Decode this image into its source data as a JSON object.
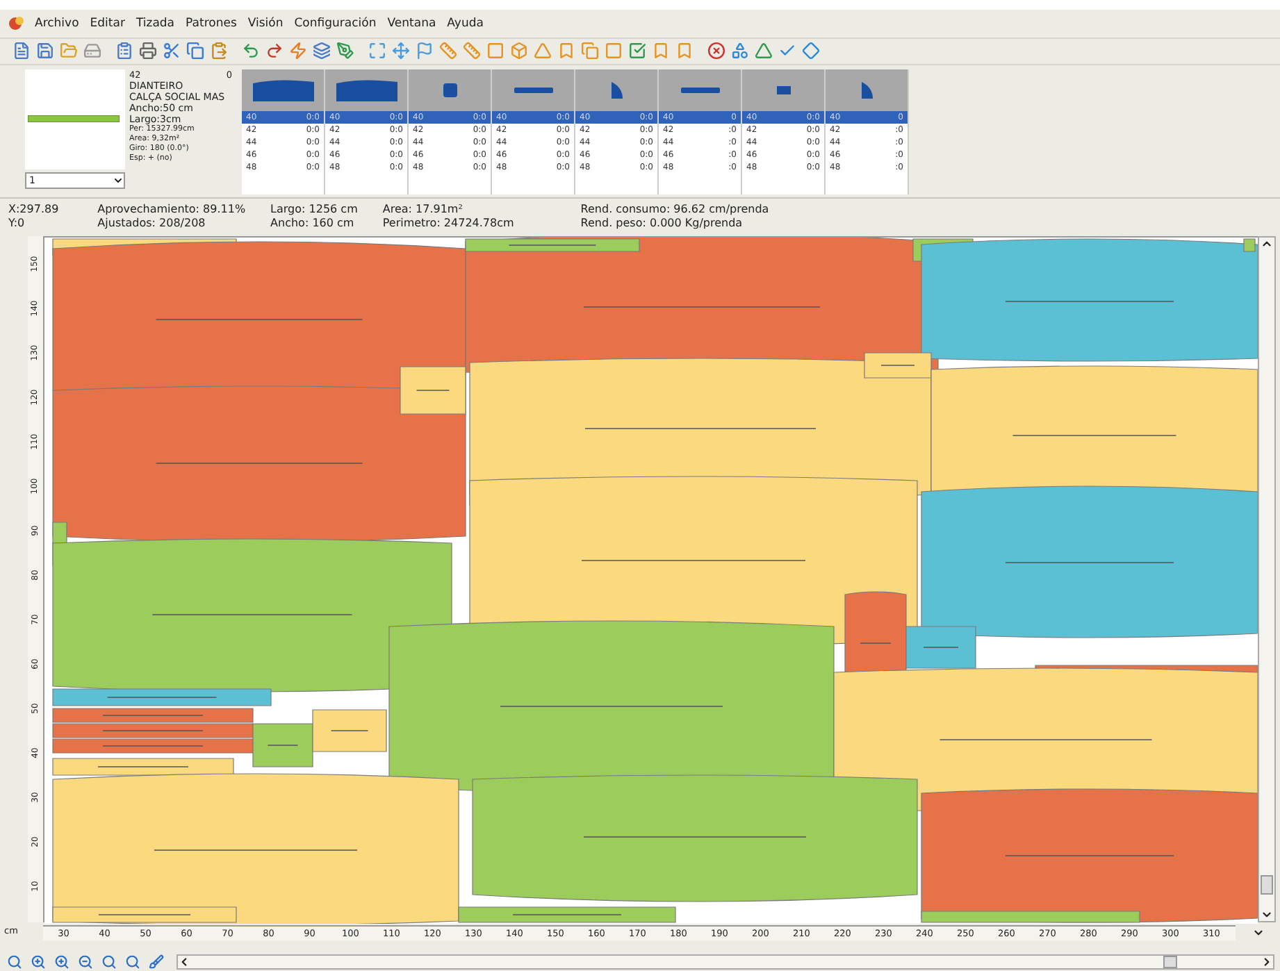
{
  "menu": [
    "Archivo",
    "Editar",
    "Tizada",
    "Patrones",
    "Visión",
    "Configuración",
    "Ventana",
    "Ayuda"
  ],
  "piece_info": {
    "size": "42",
    "count": "0",
    "lines": [
      "DIANTEIRO",
      "CALÇA SOCIAL MAS",
      "Ancho:50 cm",
      "Largo:3cm"
    ],
    "details": [
      "Per: 15327.99cm",
      "Area: 9,32m²",
      "Giro: 180 (0.0°)",
      "Esp: + (no)"
    ],
    "selector": "1"
  },
  "piece_columns": [
    {
      "kind": "panel",
      "rows": [
        {
          "size": "40",
          "qty": "0:0",
          "selected": true
        },
        {
          "size": "42",
          "qty": "0:0",
          "selected": false
        },
        {
          "size": "44",
          "qty": "0:0",
          "selected": false
        },
        {
          "size": "46",
          "qty": "0:0",
          "selected": false
        },
        {
          "size": "48",
          "qty": "0:0",
          "selected": false
        }
      ]
    },
    {
      "kind": "panel",
      "rows": [
        {
          "size": "40",
          "qty": "0:0",
          "selected": true
        },
        {
          "size": "42",
          "qty": "0:0",
          "selected": false
        },
        {
          "size": "44",
          "qty": "0:0",
          "selected": false
        },
        {
          "size": "46",
          "qty": "0:0",
          "selected": false
        },
        {
          "size": "48",
          "qty": "0:0",
          "selected": false
        }
      ]
    },
    {
      "kind": "square",
      "rows": [
        {
          "size": "40",
          "qty": "0:0",
          "selected": true
        },
        {
          "size": "42",
          "qty": "0:0",
          "selected": false
        },
        {
          "size": "44",
          "qty": "0:0",
          "selected": false
        },
        {
          "size": "46",
          "qty": "0:0",
          "selected": false
        },
        {
          "size": "48",
          "qty": "0:0",
          "selected": false
        }
      ]
    },
    {
      "kind": "bar",
      "rows": [
        {
          "size": "40",
          "qty": "0:0",
          "selected": true
        },
        {
          "size": "42",
          "qty": "0:0",
          "selected": false
        },
        {
          "size": "44",
          "qty": "0:0",
          "selected": false
        },
        {
          "size": "46",
          "qty": "0:0",
          "selected": false
        },
        {
          "size": "48",
          "qty": "0:0",
          "selected": false
        }
      ]
    },
    {
      "kind": "tab",
      "rows": [
        {
          "size": "40",
          "qty": "0:0",
          "selected": true
        },
        {
          "size": "42",
          "qty": "0:0",
          "selected": false
        },
        {
          "size": "44",
          "qty": "0:0",
          "selected": false
        },
        {
          "size": "46",
          "qty": "0:0",
          "selected": false
        },
        {
          "size": "48",
          "qty": "0:0",
          "selected": false
        }
      ]
    },
    {
      "kind": "bar",
      "rows": [
        {
          "size": "40",
          "qty": "0",
          "selected": true
        },
        {
          "size": "42",
          "qty": ":0",
          "selected": false
        },
        {
          "size": "44",
          "qty": ":0",
          "selected": false
        },
        {
          "size": "46",
          "qty": ":0",
          "selected": false
        },
        {
          "size": "48",
          "qty": ":0",
          "selected": false
        }
      ]
    },
    {
      "kind": "dot",
      "rows": [
        {
          "size": "40",
          "qty": "0:0",
          "selected": true
        },
        {
          "size": "42",
          "qty": "0:0",
          "selected": false
        },
        {
          "size": "44",
          "qty": "0:0",
          "selected": false
        },
        {
          "size": "46",
          "qty": "0:0",
          "selected": false
        },
        {
          "size": "48",
          "qty": "0:0",
          "selected": false
        }
      ]
    },
    {
      "kind": "tab",
      "rows": [
        {
          "size": "40",
          "qty": "0",
          "selected": true
        },
        {
          "size": "42",
          "qty": ":0",
          "selected": false
        },
        {
          "size": "44",
          "qty": ":0",
          "selected": false
        },
        {
          "size": "46",
          "qty": ":0",
          "selected": false
        },
        {
          "size": "48",
          "qty": ":0",
          "selected": false
        }
      ]
    }
  ],
  "status": [
    [
      "X:297.89",
      "Y:0"
    ],
    [
      "Aprovechamiento: 89.11%",
      "Ajustados: 208/208"
    ],
    [
      "Largo: 1256 cm",
      "Ancho: 160 cm"
    ],
    [
      "Area: 17.91m²",
      "Perimetro: 24724.78cm"
    ],
    [
      "Rend. consumo: 96.62 cm/prenda",
      "Rend. peso: 0.000 Kg/prenda"
    ]
  ],
  "vertical_ruler": [
    "150",
    "140",
    "130",
    "120",
    "110",
    "100",
    "90",
    "80",
    "70",
    "60",
    "50",
    "40",
    "30",
    "20",
    "10"
  ],
  "horizontal_ruler": {
    "unit": "cm",
    "ticks": [
      "30",
      "40",
      "50",
      "60",
      "70",
      "80",
      "90",
      "100",
      "110",
      "120",
      "130",
      "140",
      "150",
      "160",
      "170",
      "180",
      "190",
      "200",
      "210",
      "220",
      "230",
      "240",
      "250",
      "260",
      "270",
      "280",
      "290",
      "300",
      "310"
    ]
  }
}
